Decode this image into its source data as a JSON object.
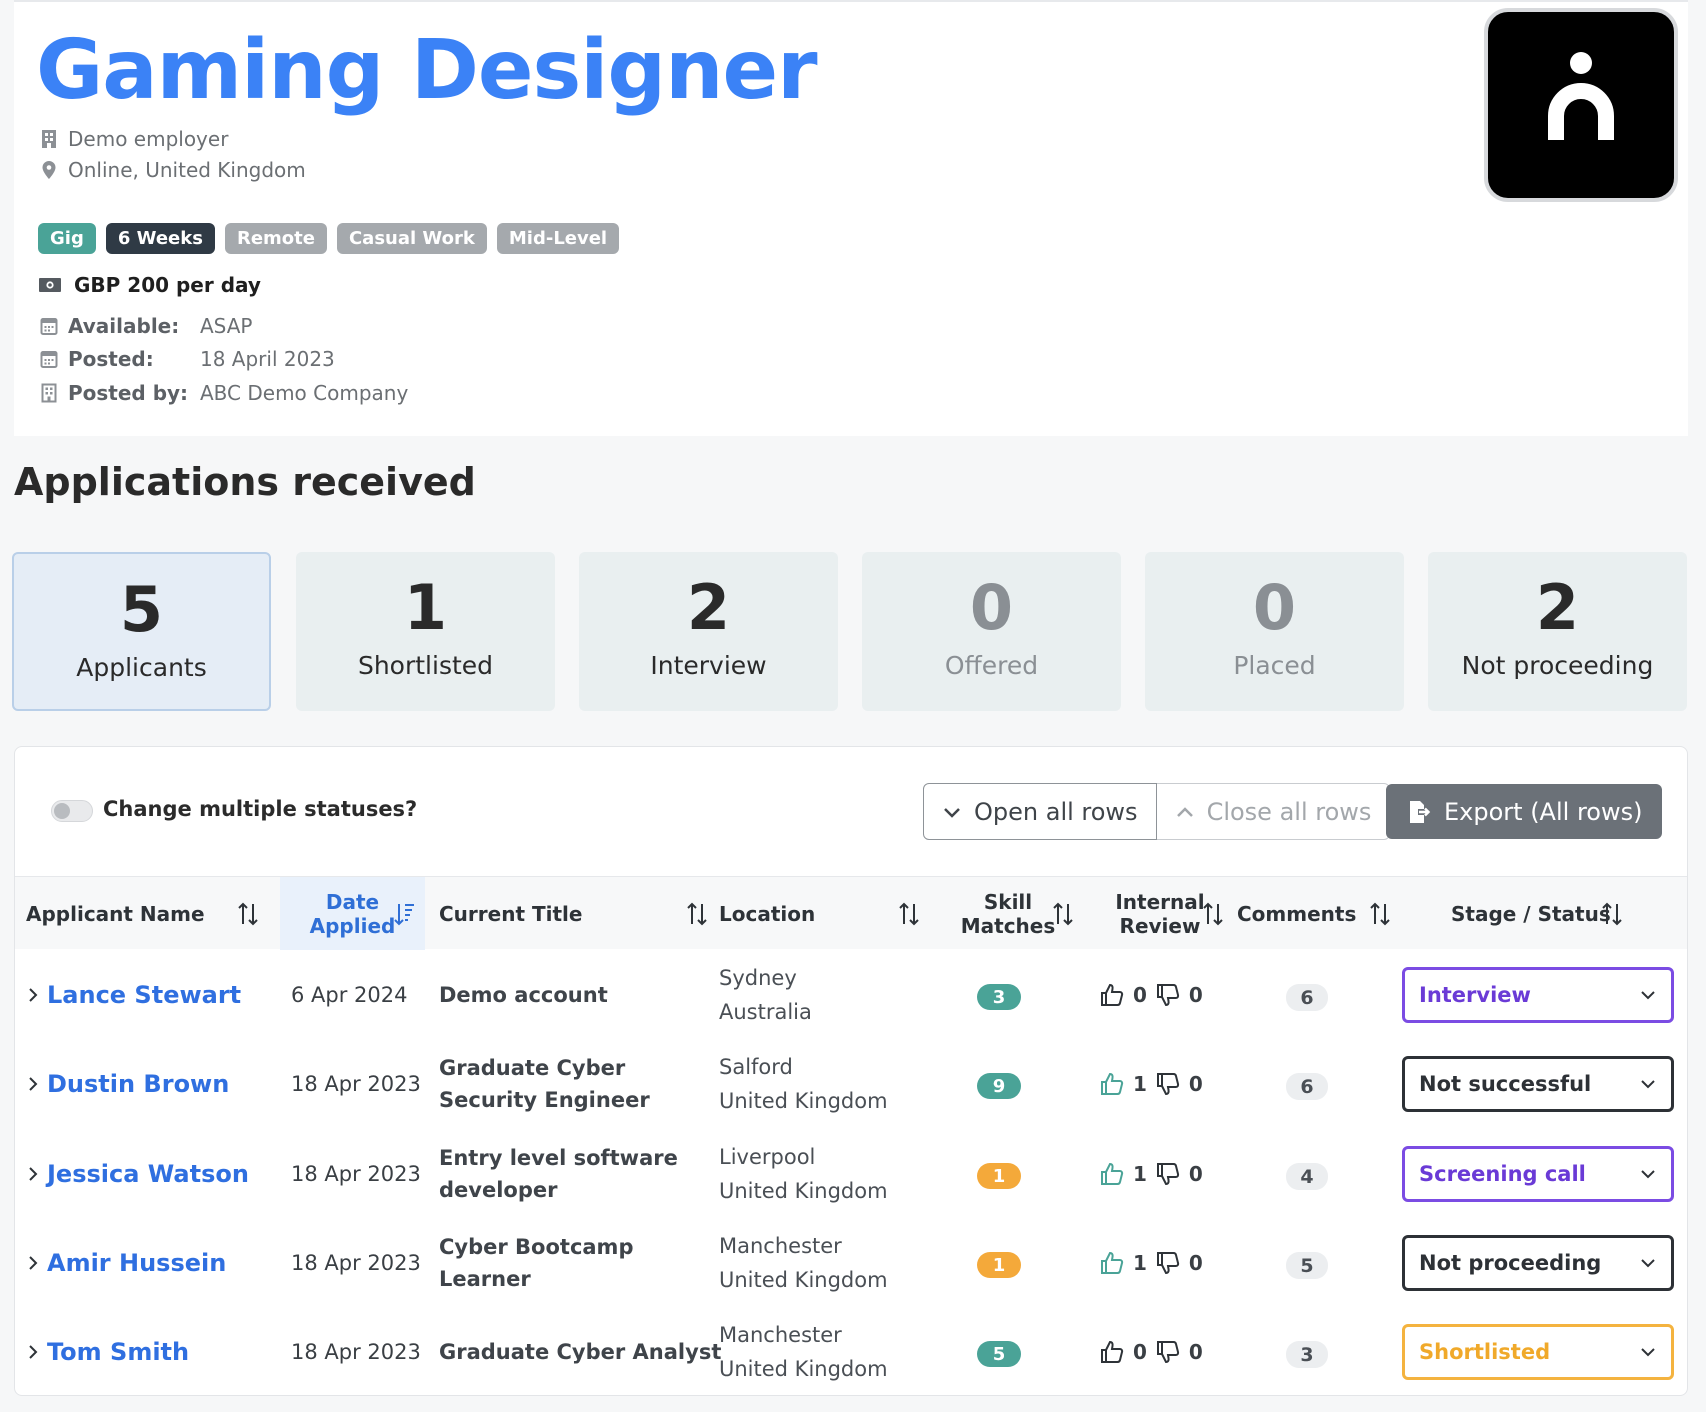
{
  "job": {
    "title": "Gaming Designer",
    "employer": "Demo employer",
    "location": "Online, United Kingdom",
    "tags": [
      "Gig",
      "6 Weeks",
      "Remote",
      "Casual Work",
      "Mid-Level"
    ],
    "salary": "GBP 200 per day",
    "details": [
      {
        "label": "Available:",
        "value": "ASAP"
      },
      {
        "label": "Posted:",
        "value": "18 April 2023"
      },
      {
        "label": "Posted by:",
        "value": "ABC Demo Company"
      }
    ]
  },
  "applications": {
    "title": "Applications received",
    "stats": [
      {
        "count": "5",
        "label": "Applicants"
      },
      {
        "count": "1",
        "label": "Shortlisted"
      },
      {
        "count": "2",
        "label": "Interview"
      },
      {
        "count": "0",
        "label": "Offered"
      },
      {
        "count": "0",
        "label": "Placed"
      },
      {
        "count": "2",
        "label": "Not proceeding"
      }
    ]
  },
  "toolbar": {
    "toggle_label": "Change multiple statuses?",
    "open_rows": "Open all rows",
    "close_rows": "Close all rows",
    "export": "Export (All rows)"
  },
  "table": {
    "headers": {
      "name": "Applicant Name",
      "date_1": "Date",
      "date_2": "Applied",
      "title": "Current Title",
      "location": "Location",
      "skill_1": "Skill",
      "skill_2": "Matches",
      "review_1": "Internal",
      "review_2": "Review",
      "comments": "Comments",
      "status": "Stage / Status"
    },
    "rows": [
      {
        "name": "Lance Stewart",
        "date": "6 Apr 2024",
        "title": "Demo account",
        "city": "Sydney",
        "country": "Australia",
        "skills": "3",
        "up": "0",
        "down": "0",
        "comments": "6",
        "status": "Interview"
      },
      {
        "name": "Dustin Brown",
        "date": "18 Apr 2023",
        "title": "Graduate Cyber Security Engineer",
        "city": "Salford",
        "country": "United Kingdom",
        "skills": "9",
        "up": "1",
        "down": "0",
        "comments": "6",
        "status": "Not successful"
      },
      {
        "name": "Jessica Watson",
        "date": "18 Apr 2023",
        "title": "Entry level software developer",
        "city": "Liverpool",
        "country": "United Kingdom",
        "skills": "1",
        "up": "1",
        "down": "0",
        "comments": "4",
        "status": "Screening call"
      },
      {
        "name": "Amir Hussein",
        "date": "18 Apr 2023",
        "title": "Cyber Bootcamp Learner",
        "city": "Manchester",
        "country": "United Kingdom",
        "skills": "1",
        "up": "1",
        "down": "0",
        "comments": "5",
        "status": "Not proceeding"
      },
      {
        "name": "Tom Smith",
        "date": "18 Apr 2023",
        "title": "Graduate Cyber Analyst",
        "city": "Manchester",
        "country": "United Kingdom",
        "skills": "5",
        "up": "0",
        "down": "0",
        "comments": "3",
        "status": "Shortlisted"
      }
    ]
  },
  "colors": {
    "accent": "#3b82f6",
    "teal": "#4aa397",
    "orange": "#f4a93a",
    "purple": "#7b4ce3"
  }
}
